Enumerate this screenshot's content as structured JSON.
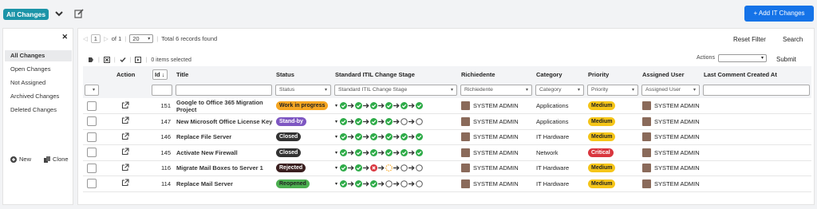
{
  "header": {
    "view_label": "All Changes",
    "add_button": "Add IT Changes"
  },
  "sidebar": {
    "items": [
      {
        "label": "All Changes",
        "active": true
      },
      {
        "label": "Open Changes",
        "active": false
      },
      {
        "label": "Not Assigned",
        "active": false
      },
      {
        "label": "Archived Changes",
        "active": false
      },
      {
        "label": "Deleted Changes",
        "active": false
      }
    ],
    "new_label": "New",
    "clone_label": "Clone"
  },
  "toolbar": {
    "page": "1",
    "of_text": "of 1",
    "per_page": "20",
    "total_text": "Total 6 records found",
    "reset_label": "Reset Filter",
    "search_label": "Search",
    "actions_label": "Actions",
    "submit_label": "Submit",
    "selected_text": "0 items selected"
  },
  "columns": {
    "action": "Action",
    "id": "Id",
    "title": "Title",
    "status": "Status",
    "stage": "Standard ITIL Change Stage",
    "requester": "Richiedente",
    "category": "Category",
    "priority": "Priority",
    "assigned": "Assigned User",
    "last_comment": "Last Comment Created At"
  },
  "filters": {
    "status": "Status",
    "stage": "Standard ITIL Change Stage",
    "requester": "Richiedente",
    "category": "Category",
    "priority": "Priority",
    "assigned": "Assigned User"
  },
  "colors": {
    "accent": "#1573e8",
    "view_badge": "#1c94a8",
    "stage_done": "#2eab48",
    "stage_failed": "#d9363e"
  },
  "rows": [
    {
      "id": "151",
      "title": "Google to Office 365 Migration Project",
      "status": "Work in progress",
      "status_bg": "#f5a623",
      "status_fg": "#222",
      "stages": [
        "done",
        "done",
        "done",
        "done",
        "done",
        "done"
      ],
      "requester": "SYSTEM ADMIN",
      "category": "Applications",
      "priority": "Medium",
      "priority_bg": "#f5c518",
      "priority_fg": "#222",
      "assigned": "SYSTEM ADMIN"
    },
    {
      "id": "147",
      "title": "New Microsoft Office License Key",
      "status": "Stand-by",
      "status_bg": "#7e57c2",
      "status_fg": "#fff",
      "stages": [
        "done",
        "done",
        "done",
        "done",
        "empty",
        "empty"
      ],
      "requester": "SYSTEM ADMIN",
      "category": "Applications",
      "priority": "Medium",
      "priority_bg": "#f5c518",
      "priority_fg": "#222",
      "assigned": "SYSTEM ADMIN"
    },
    {
      "id": "146",
      "title": "Replace File Server",
      "status": "Closed",
      "status_bg": "#333",
      "status_fg": "#fff",
      "stages": [
        "done",
        "done",
        "done",
        "done",
        "done",
        "done"
      ],
      "requester": "SYSTEM ADMIN",
      "category": "IT Hardware",
      "priority": "Medium",
      "priority_bg": "#f5c518",
      "priority_fg": "#222",
      "assigned": "SYSTEM ADMIN"
    },
    {
      "id": "145",
      "title": "Activate New Firewall",
      "status": "Closed",
      "status_bg": "#333",
      "status_fg": "#fff",
      "stages": [
        "done",
        "done",
        "done",
        "done",
        "done",
        "done"
      ],
      "requester": "SYSTEM ADMIN",
      "category": "Network",
      "priority": "Critical",
      "priority_bg": "#d9363e",
      "priority_fg": "#fff",
      "assigned": "SYSTEM ADMIN"
    },
    {
      "id": "116",
      "title": "Migrate Mail Boxes to Server 1",
      "status": "Rejected",
      "status_bg": "#3a1f1f",
      "status_fg": "#fff",
      "stages": [
        "done",
        "done",
        "failed",
        "pending",
        "empty",
        "empty"
      ],
      "requester": "SYSTEM ADMIN",
      "category": "IT Hardware",
      "priority": "Medium",
      "priority_bg": "#f5c518",
      "priority_fg": "#222",
      "assigned": "SYSTEM ADMIN"
    },
    {
      "id": "114",
      "title": "Replace Mail Server",
      "status": "Reopened",
      "status_bg": "#4caf50",
      "status_fg": "#222",
      "stages": [
        "done",
        "done",
        "done",
        "empty",
        "empty",
        "empty"
      ],
      "requester": "SYSTEM ADMIN",
      "category": "IT Hardware",
      "priority": "Medium",
      "priority_bg": "#f5c518",
      "priority_fg": "#222",
      "assigned": "SYSTEM ADMIN"
    }
  ]
}
